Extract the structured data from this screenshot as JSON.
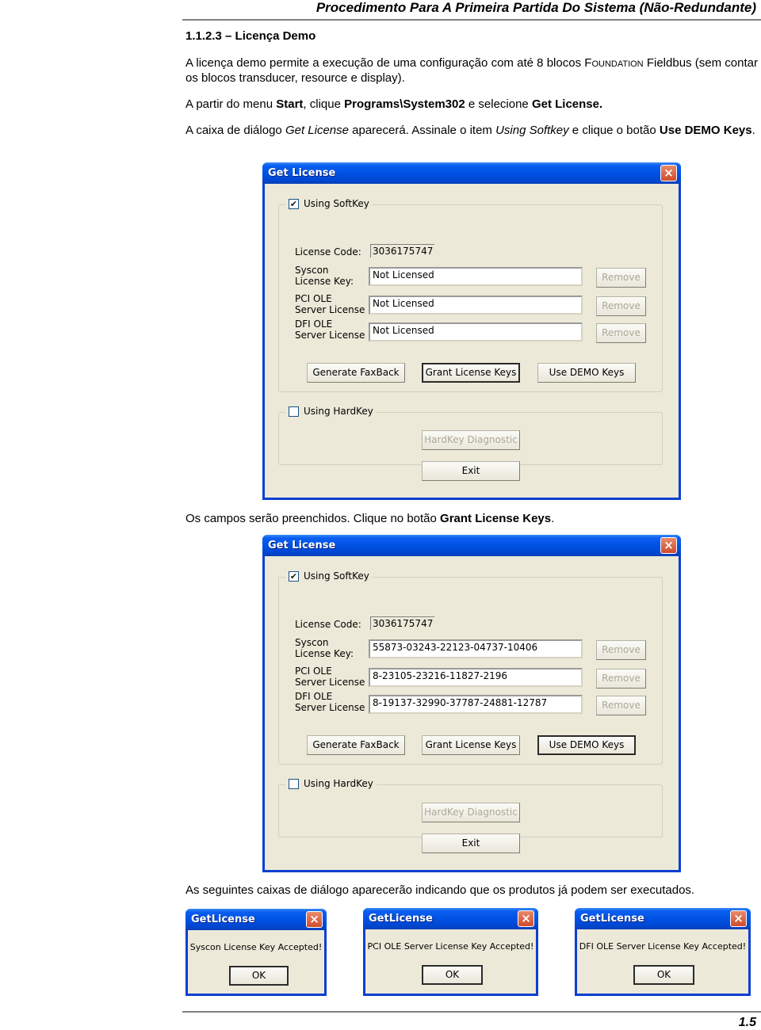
{
  "header": {
    "title": "Procedimento Para A Primeira Partida Do Sistema (Não-Redundante)"
  },
  "section": {
    "heading": "1.1.2.3 – Licença Demo"
  },
  "paragraphs": {
    "p1_a": "A licença demo permite a execução de uma configuração com  até 8 blocos ",
    "p1_sc": "Foundation",
    "p1_b": " Fieldbus (sem contar os blocos transducer, resource e display).",
    "p2_a": "A partir do menu ",
    "p2_b": "Start",
    "p2_c": ", clique ",
    "p2_d": "Programs\\System302",
    "p2_e": " e selecione ",
    "p2_f": "Get License.",
    "p3_a": "A caixa de diálogo ",
    "p3_b": "Get License",
    "p3_c": " aparecerá. Assinale o item ",
    "p3_d": "Using Softkey",
    "p3_e": " e clique o botão ",
    "p3_f": "Use DEMO Keys",
    "p3_g": ".",
    "p4_a": "Os campos serão preenchidos. Clique no botão ",
    "p4_b": "Grant License Keys",
    "p4_c": ".",
    "p5": "As seguintes caixas de diálogo aparecerão indicando que os produtos já podem ser executados."
  },
  "dialog1": {
    "title": "Get License",
    "close_icon": "×",
    "softkey_label": "Using SoftKey",
    "softkey_checked": "✔",
    "license_code_label": "License Code:",
    "license_code_value": "3036175747",
    "syscon_label": "Syscon\nLicense Key:",
    "syscon_value": "Not Licensed",
    "pci_label": "PCI OLE\nServer License",
    "pci_value": "Not Licensed",
    "dfi_label": "DFI OLE\nServer License",
    "dfi_value": "Not Licensed",
    "remove_label": "Remove",
    "generate_label": "Generate FaxBack",
    "grant_label": "Grant License Keys",
    "demo_label": "Use DEMO Keys",
    "hardkey_label": "Using HardKey",
    "hardkey_diag_label": "HardKey Diagnostic",
    "exit_label": "Exit"
  },
  "dialog2": {
    "title": "Get License",
    "close_icon": "×",
    "softkey_label": "Using SoftKey",
    "softkey_checked": "✔",
    "license_code_label": "License Code:",
    "license_code_value": "3036175747",
    "syscon_label": "Syscon\nLicense Key:",
    "syscon_value": "55873-03243-22123-04737-10406",
    "pci_label": "PCI OLE\nServer License",
    "pci_value": "8-23105-23216-11827-2196",
    "dfi_label": "DFI OLE\nServer License",
    "dfi_value": "8-19137-32990-37787-24881-12787",
    "remove_label": "Remove",
    "generate_label": "Generate FaxBack",
    "grant_label": "Grant License Keys",
    "demo_label": "Use DEMO Keys",
    "hardkey_label": "Using HardKey",
    "hardkey_diag_label": "HardKey Diagnostic",
    "exit_label": "Exit"
  },
  "messages": [
    {
      "title": "GetLicense",
      "text": "Syscon License Key Accepted!",
      "ok": "OK",
      "close_icon": "×"
    },
    {
      "title": "GetLicense",
      "text": "PCI OLE Server License Key Accepted!",
      "ok": "OK",
      "close_icon": "×"
    },
    {
      "title": "GetLicense",
      "text": "DFI OLE Server License Key Accepted!",
      "ok": "OK",
      "close_icon": "×"
    }
  ],
  "footer": {
    "page_number": "1.5"
  }
}
